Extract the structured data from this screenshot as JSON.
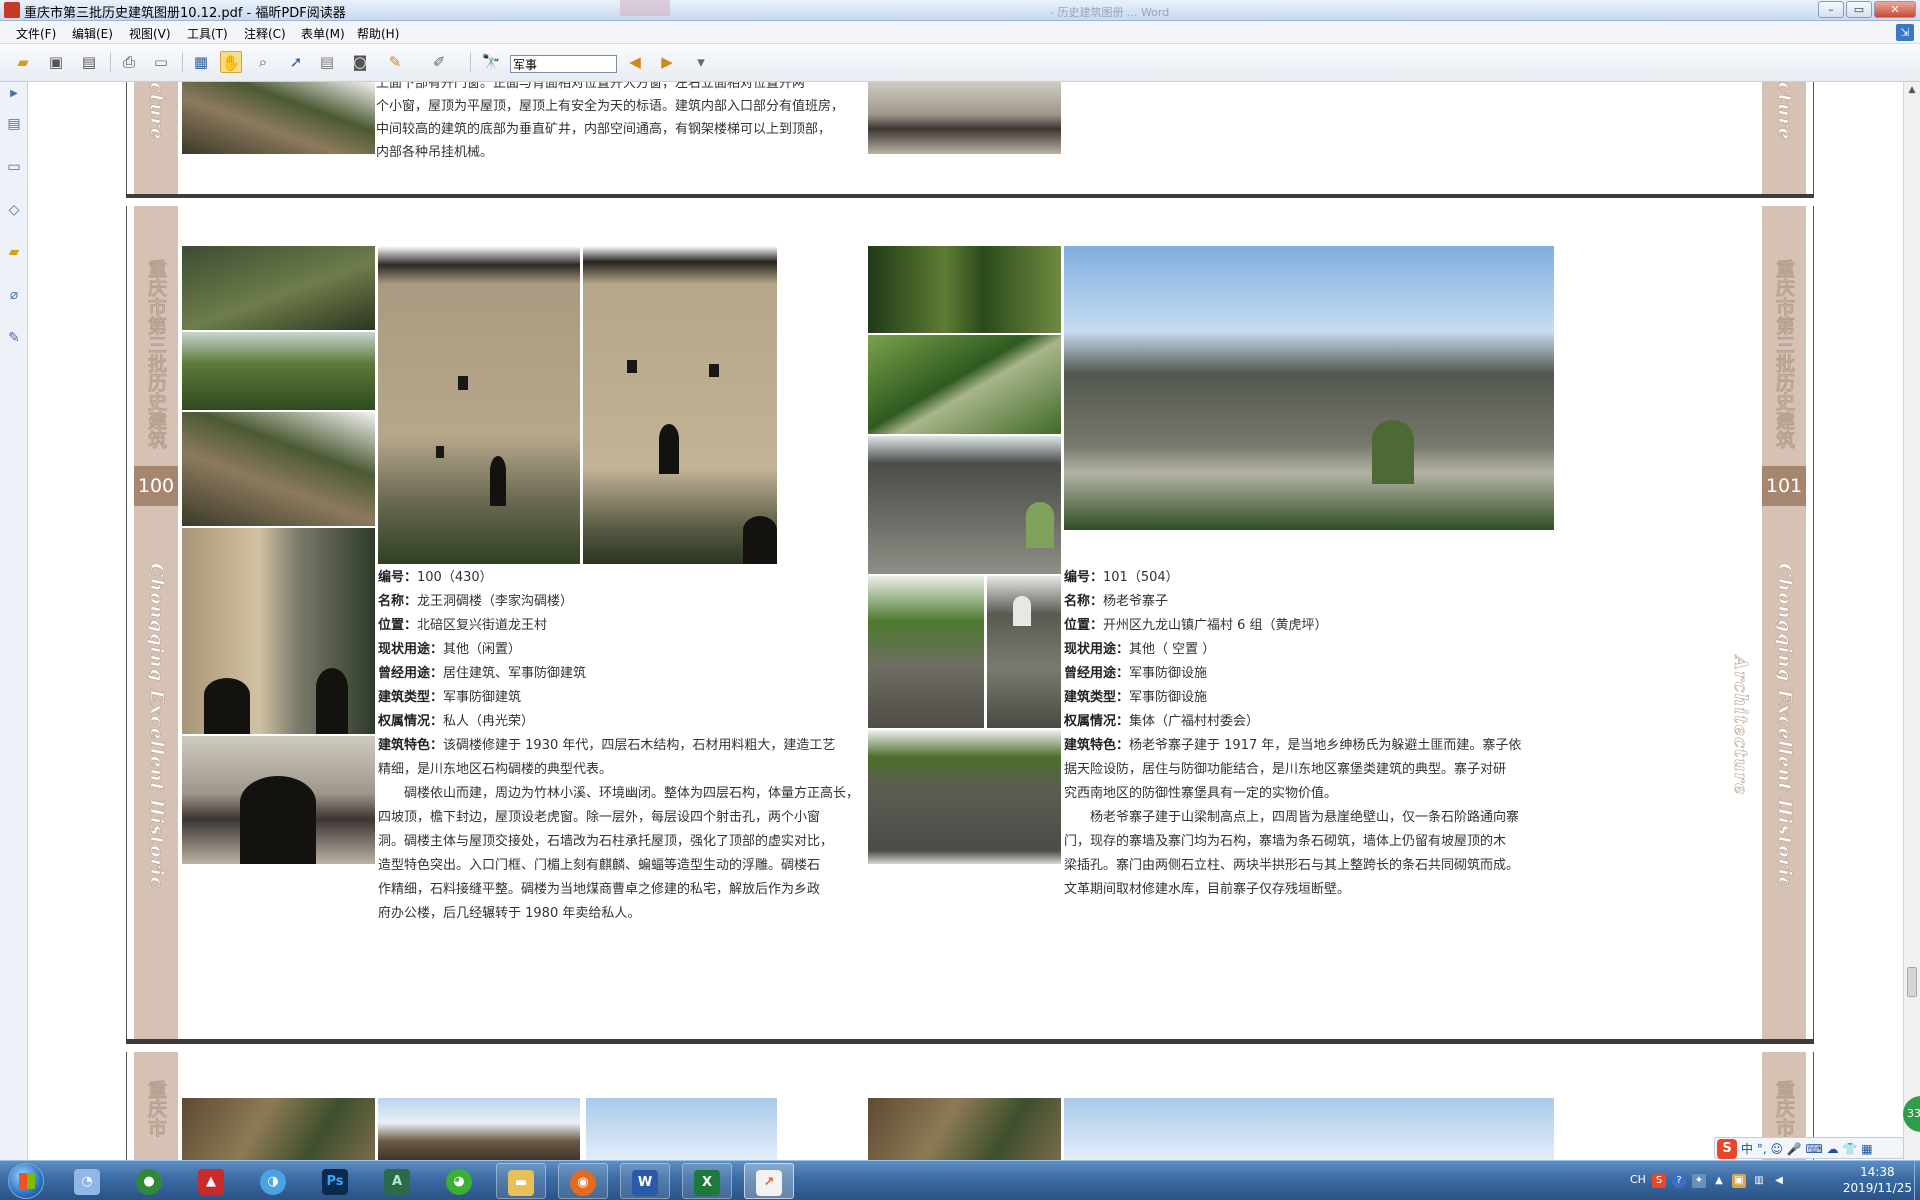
{
  "window": {
    "title": "重庆市第三批历史建筑图册10.12.pdf - 福昕PDF阅读器",
    "background_title": "- 历史建筑图册 ... Word"
  },
  "menu": [
    "文件(F)",
    "编辑(E)",
    "视图(V)",
    "工具(T)",
    "注释(C)",
    "表单(M)",
    "帮助(H)"
  ],
  "toolbar": {
    "search_value": "军事",
    "icons": [
      "open-icon",
      "save-icon",
      "save-all-icon",
      "print-icon",
      "snapshot-icon",
      "fullscreen-icon",
      "hand-tool-icon",
      "zoom-tool-icon",
      "select-arrow-icon",
      "text-select-icon",
      "snapshot-camera-icon",
      "sign-icon",
      "typewriter-icon",
      "find-icon",
      "find-prev-icon",
      "find-next-icon",
      "options-icon"
    ]
  },
  "sidebar": [
    "expand-icon",
    "pages-icon",
    "layers-icon",
    "bookmarks-icon",
    "comments-icon",
    "attachments-icon",
    "signatures-icon"
  ],
  "prev_page": {
    "text_lines": [
      "上面下部有开门窗。正面与背面相对位置开大方窗，左右立面相对位置开两",
      "个小窗，屋顶为平屋顶，屋顶上有安全为天的标语。建筑内部入口部分有值班房，",
      "中间较高的建筑的底部为垂直矿井，内部空间通高，有钢架楼梯可以上到顶部，",
      "内部各种吊挂机械。"
    ]
  },
  "spread": {
    "band_title": "重庆市第三批历史建筑",
    "band_english": "Chongqing Excellent Historic Architecture",
    "left": {
      "page_number": "100",
      "entry": [
        {
          "label": "编号：",
          "value": "100（430）"
        },
        {
          "label": "名称：",
          "value": "龙王洞碉楼（李家沟碉楼）"
        },
        {
          "label": "位置：",
          "value": "北碚区复兴街道龙王村"
        },
        {
          "label": "现状用途：",
          "value": "其他（闲置）"
        },
        {
          "label": "曾经用途：",
          "value": "居住建筑、军事防御建筑"
        },
        {
          "label": "建筑类型：",
          "value": "军事防御建筑"
        },
        {
          "label": "权属情况：",
          "value": "私人（冉光荣）"
        }
      ],
      "feature_label": "建筑特色：",
      "feature_lines": [
        "该碉楼修建于 1930 年代，四层石木结构，石材用料粗大，建造工艺",
        "精细，是川东地区石构碉楼的典型代表。"
      ],
      "para_lines": [
        "碉楼依山而建，周边为竹林小溪、环境幽闭。整体为四层石构，体量方正高长，",
        "四坡顶，檐下封边，屋顶设老虎窗。除一层外，每层设四个射击孔，两个小窗",
        "洞。碉楼主体与屋顶交接处，石墙改为石柱承托屋顶，强化了顶部的虚实对比，",
        "造型特色突出。入口门框、门楣上刻有麒麟、蝙蝠等造型生动的浮雕。碉楼石",
        "作精细，石料接缝平整。碉楼为当地煤商曹卓之修建的私宅，解放后作为乡政",
        "府办公楼，后几经辗转于 1980 年卖给私人。"
      ]
    },
    "right": {
      "page_number": "101",
      "entry": [
        {
          "label": "编号：",
          "value": "101（504）"
        },
        {
          "label": "名称：",
          "value": "杨老爷寨子"
        },
        {
          "label": "位置：",
          "value": "开州区九龙山镇广福村 6 组（黄虎坪）"
        },
        {
          "label": "现状用途：",
          "value": "其他（ 空置 ）"
        },
        {
          "label": "曾经用途：",
          "value": "军事防御设施"
        },
        {
          "label": "建筑类型：",
          "value": "军事防御设施"
        },
        {
          "label": "权属情况：",
          "value": "集体（广福村村委会）"
        }
      ],
      "feature_label": "建筑特色：",
      "feature_lines": [
        "杨老爷寨子建于 1917 年，是当地乡绅杨氏为躲避土匪而建。寨子依",
        "据天险设防，居住与防御功能结合，是川东地区寨堡类建筑的典型。寨子对研",
        "究西南地区的防御性寨堡具有一定的实物价值。"
      ],
      "para_lines": [
        "杨老爷寨子建于山梁制高点上，四周皆为悬崖绝壁山，仅一条石阶路通向寨",
        "门，现存的寨墙及寨门均为石构，寨墙为条石砌筑，墙体上仍留有坡屋顶的木",
        "梁插孔。寨门由两侧石立柱、两块半拱形石与其上整跨长的条石共同砌筑而成。",
        "文革期间取材修建水库，目前寨子仅存残垣断壁。"
      ]
    }
  },
  "next_page": {
    "band_title": "重庆市"
  },
  "ime_bar": {
    "text": "中 °, ☺ 🎤 ⌨ ☁ 👕 ▦"
  },
  "taskbar": {
    "apps": [
      "start-orb",
      "ie-tool-icon",
      "green-app-icon",
      "autocad-icon",
      "cloud-icon",
      "photoshop-icon",
      "adobe-icon",
      "wechat-icon",
      "folder-icon",
      "firefox-icon",
      "word-icon",
      "excel-icon",
      "foxit-icon"
    ],
    "tray_lang": "CH",
    "time": "14:38",
    "date": "2019/11/25"
  }
}
